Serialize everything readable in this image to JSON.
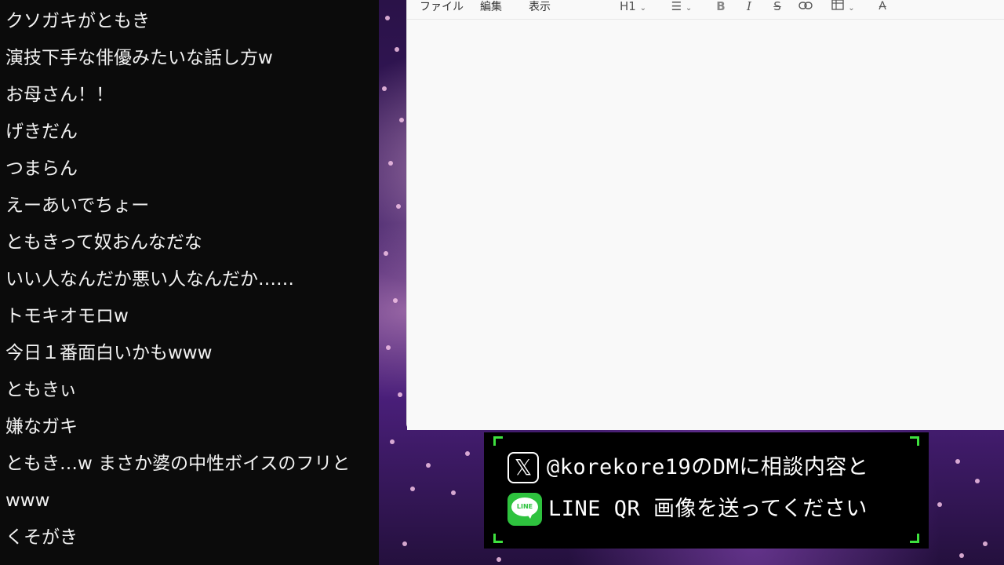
{
  "chat": {
    "messages": [
      "クソガキがともき",
      "演技下手な俳優みたいな話し方w",
      "お母さん！！",
      "げきだん",
      "つまらん",
      "えーあいでちょー",
      "ともきって奴おんなだな",
      "いい人なんだか悪い人なんだか……",
      "トモキオモロw",
      "今日１番面白いかもwww",
      "ともきぃ",
      "嫌なガキ",
      "ともき…w まさか婆の中性ボイスのフリと",
      "www",
      "くそがき"
    ]
  },
  "editor": {
    "menu": {
      "file": "ファイル",
      "edit": "編集",
      "view": "表示"
    },
    "toolbar": {
      "heading": "H1",
      "bold": "B",
      "italic": "I",
      "strike": "S",
      "link_icon": "link-icon",
      "list_icon": "bulleted-list-icon",
      "table_icon": "table-icon",
      "spell_icon": "spellcheck-icon"
    }
  },
  "banner": {
    "x_glyph": "𝕏",
    "line1": "@korekore19のDMに相談内容と",
    "line_logo_text": "LINE",
    "line2": "LINE QR 画像を送ってください",
    "accent_color": "#3ee13e",
    "line_color": "#2ec23e"
  }
}
